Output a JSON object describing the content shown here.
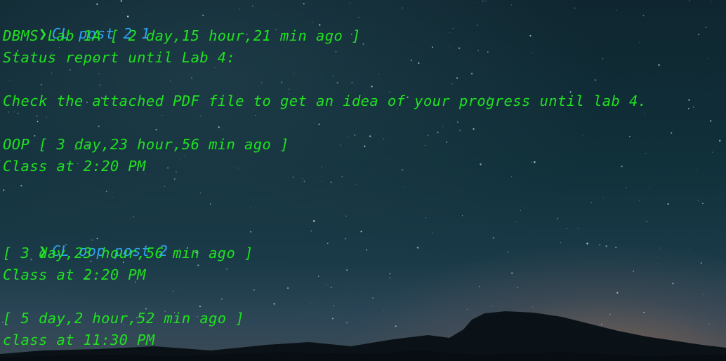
{
  "prompt_symbol": "❯",
  "colors": {
    "output_text": "#20e020",
    "command_text": "#2fa3f0",
    "prompt_arrow": "#2ee02e"
  },
  "session": [
    {
      "command": "CL post 2 1",
      "output": [
        "DBMS Lab 1A [ 2 day,15 hour,21 min ago ]",
        "Status report until Lab 4:",
        "",
        "Check the attached PDF file to get an idea of your progress until lab 4.",
        "",
        "OOP [ 3 day,23 hour,56 min ago ]",
        "Class at 2:20 PM"
      ]
    },
    {
      "command": "CL oop post 2",
      "output": [
        "[ 3 day,23 hour,56 min ago ]",
        "Class at 2:20 PM",
        "",
        "[ 5 day,2 hour,52 min ago ]",
        "class at 11:30 PM"
      ]
    }
  ]
}
